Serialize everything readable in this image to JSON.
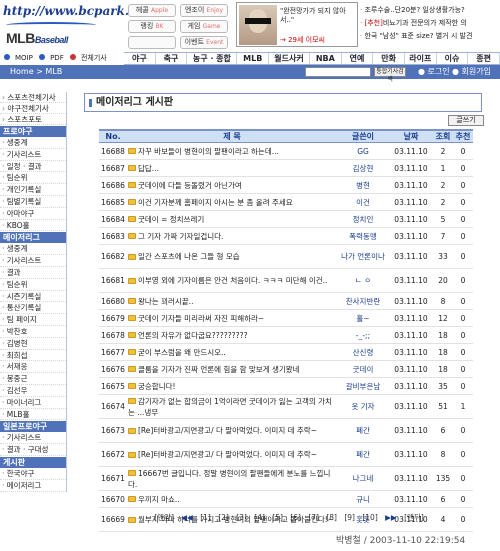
{
  "header": {
    "logo_url": "http://www.bcpark.net",
    "logo_main": "MLB",
    "logo_sub": "Baseball",
    "quick_links": [
      {
        "label": "헤콜",
        "sub": "Apple"
      },
      {
        "label": "엔조이",
        "sub": "Enjoy"
      },
      {
        "label": "랭킹",
        "sub": "BK"
      },
      {
        "label": "게임",
        "sub": "Game"
      },
      {
        "label": "",
        "sub": ""
      },
      {
        "label": "이벤트",
        "sub": "Event"
      }
    ],
    "ad": {
      "text": "\"완전망가가 되지 않아서..\"",
      "link": "→ 29세 이모씨"
    },
    "news": [
      {
        "prefix": "·",
        "text": "조루수술..단20분? 일상생활가능?"
      },
      {
        "prefix": "·",
        "tag": "[추천]",
        "text": "비뇨기과 전문의가 제작한 의"
      },
      {
        "prefix": "·",
        "text": "한국 \"남성\" 표준 size? 별거 시 발견"
      }
    ],
    "brand_strip": [
      "MOIP",
      "PDF",
      "전체기사"
    ]
  },
  "main_nav": [
    "야구",
    "축구",
    "농구 · 종합",
    "MLB",
    "월드사커",
    "NBA",
    "연예",
    "만화",
    "라이프",
    "이슈",
    "종편"
  ],
  "crumb": "Home > MLB",
  "search": {
    "placeholder": "",
    "button": "통합기사검색"
  },
  "account": {
    "login": "로그인",
    "join": "회원가입"
  },
  "sidebar": {
    "top_items": [
      "스포츠전체기사",
      "야구전체기사",
      "스포츠포토"
    ],
    "sections": [
      {
        "title": "프로야구",
        "items": [
          "생중계",
          "기사리스트",
          "일정 · 결과",
          "팀순위",
          "개인기록실",
          "팀별기록실",
          "아마야구",
          "KBO홀"
        ]
      },
      {
        "title": "메이저리그",
        "items": [
          "생중계",
          "기사리스트",
          "결과",
          "팀순위",
          "시즌기록실",
          "통산기록실",
          "팀 페이지",
          "박찬호",
          "김병현",
          "최희섭",
          "서재응",
          "봉중근",
          "김선우",
          "마이너리그",
          "MLB홀"
        ]
      },
      {
        "title": "일본프로야구",
        "items": [
          "기사리스트",
          "결과 · 구대성"
        ]
      },
      {
        "title": "게시판",
        "items": [
          "한국야구",
          "메이저리그"
        ]
      }
    ]
  },
  "board": {
    "title": "메이저리그 게시판",
    "write_label": "글쓰기",
    "columns": [
      "No.",
      "제 목",
      "글쓴이",
      "날짜",
      "조회",
      "추천"
    ],
    "rows": [
      {
        "no": "16688",
        "title": "자꾸 바보들이 병현이의 팔팬이라고 하는데...",
        "writer": "GG",
        "date": "03.11.10",
        "views": "2",
        "rec": "0"
      },
      {
        "no": "16687",
        "title": "답답...",
        "writer": "김상현",
        "date": "03.11.10",
        "views": "1",
        "rec": "0"
      },
      {
        "no": "16686",
        "title": "굿데이에 다들 등돌렸거 아닌가여",
        "writer": "병현",
        "date": "03.11.10",
        "views": "2",
        "rec": "0"
      },
      {
        "no": "16685",
        "title": "이건 기자분께 홈페이지 아시는 분 좀 올려 주세요",
        "writer": "이건",
        "date": "03.11.10",
        "views": "2",
        "rec": "0"
      },
      {
        "no": "16684",
        "title": "굿데이 = 정치쓰레기",
        "writer": "정치인",
        "date": "03.11.10",
        "views": "5",
        "rec": "0"
      },
      {
        "no": "16683",
        "title": "그 기자 가짜 기자일겁니다.",
        "writer": "폭력동맹",
        "date": "03.11.10",
        "views": "7",
        "rec": "0"
      },
      {
        "no": "16682",
        "title": "일간 스포츠에 나온 그들 형 모습",
        "writer": "나가 언론이나",
        "date": "03.11.10",
        "views": "33",
        "rec": "0"
      },
      {
        "no": "16681",
        "title": "이부영 외에 기자이름은 안건 처음이다. ㅋㅋㅋ 미단해 이건..",
        "writer": "ㄴ ㅇ",
        "date": "03.11.10",
        "views": "20",
        "rec": "0"
      },
      {
        "no": "16680",
        "title": "왕나는 꾀러시끝..",
        "writer": "찬사지반란",
        "date": "03.11.10",
        "views": "8",
        "rec": "0"
      },
      {
        "no": "16679",
        "title": "굿데이 기자들 미리라써 자진 피해하라~",
        "writer": "홀~",
        "date": "03.11.10",
        "views": "12",
        "rec": "0"
      },
      {
        "no": "16678",
        "title": "언론의 자유가 없다굽요?????????",
        "writer": "-_-;;",
        "date": "03.11.10",
        "views": "18",
        "rec": "0"
      },
      {
        "no": "16677",
        "title": "굳이 부스럼을 왜 만드시오..",
        "writer": "산신령",
        "date": "03.11.10",
        "views": "18",
        "rec": "0"
      },
      {
        "no": "16676",
        "title": "클룸을 기자가 진짜 언론에 힘을 함 맞보게 생기봤네",
        "writer": "굿데이",
        "date": "03.11.10",
        "views": "18",
        "rec": "0"
      },
      {
        "no": "16675",
        "title": "궁승합니다!",
        "writer": "갈비부은남",
        "date": "03.11.10",
        "views": "35",
        "rec": "0"
      },
      {
        "no": "16674",
        "title": "감기자가 없는 합의금이 1억이라면 굿데이가 잃는 고객의 가치는 ...냉무",
        "writer": "옷 기자",
        "date": "03.11.10",
        "views": "51",
        "rec": "1"
      },
      {
        "no": "16673",
        "title": "[Re]터바광고/지면광고/ 다 팔아먹었다. 이미지 데 추락~",
        "writer": "폐간",
        "date": "03.11.10",
        "views": "6",
        "rec": "0"
      },
      {
        "no": "16672",
        "title": "[Re]터바광고/지면광고/ 다 팔아먹었다. 이미지 데 추락~",
        "writer": "폐간",
        "date": "03.11.10",
        "views": "8",
        "rec": "0"
      },
      {
        "no": "16671",
        "title": "16667번 글입니다. 정말 병현이의 팔팬들에게 분노를 느낍니다.",
        "writer": "나그네",
        "date": "03.11.10",
        "views": "135",
        "rec": "0"
      },
      {
        "no": "16670",
        "title": "우끼지 마쇼..",
        "writer": "규니",
        "date": "03.11.10",
        "views": "6",
        "rec": "0"
      },
      {
        "no": "16669",
        "title": "월부지 아마 하나를 가지고 병현이의 팔팬이라고 몰아붙인다!~",
        "writer": "홋홋",
        "date": "03.11.10",
        "views": "4",
        "rec": "0"
      }
    ]
  },
  "pager": {
    "first": "[맨앞]",
    "prev": "◀◀",
    "pages": [
      "[1]",
      "[2]",
      "[3]",
      "[4]",
      "[5]",
      "[6]",
      "[7]",
      "[8]",
      "[9]",
      "[10]"
    ],
    "next": "▶▶",
    "last": "[맨뒤]"
  },
  "caption": "박병철 / 2003-11-10 22:19:54"
}
